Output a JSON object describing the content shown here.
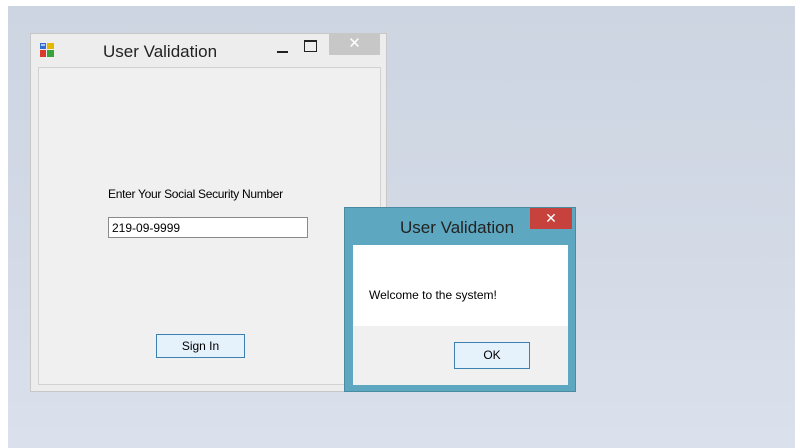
{
  "main_window": {
    "title": "User Validation",
    "icon": "form-app-icon",
    "controls": {
      "minimize": "minimize-icon",
      "maximize": "maximize-icon",
      "close": "✕"
    },
    "prompt": "Enter Your Social Security Number",
    "ssn_value": "219-09-9999",
    "signin_label": "Sign In"
  },
  "message_box": {
    "title": "User Validation",
    "close": "✕",
    "message": "Welcome to the system!",
    "ok_label": "OK"
  },
  "colors": {
    "desktop": "#cdd5e2",
    "msgbox_frame": "#5ea7c0",
    "msgbox_close": "#c7423c"
  }
}
